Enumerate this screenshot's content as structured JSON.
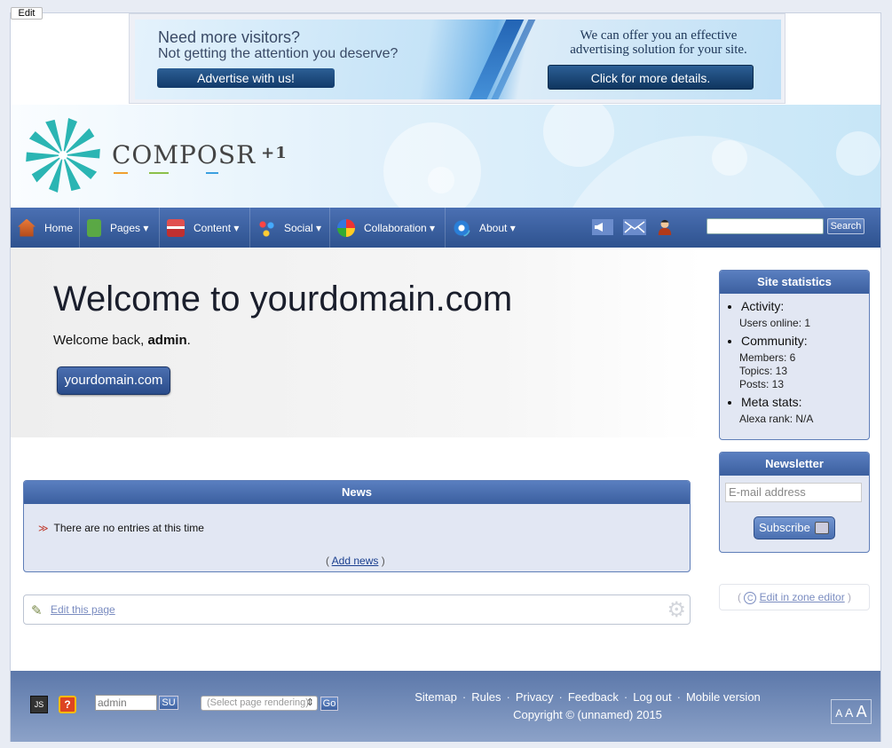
{
  "edit_tab": "Edit",
  "banner": {
    "line1": "Need more visitors?",
    "line2": "Not getting the attention you deserve?",
    "left_button": "Advertise with us!",
    "right_text": "We can offer you an effective advertising solution for your site.",
    "right_button": "Click for more details."
  },
  "logo": {
    "name": "COMPOSR",
    "suffix": "+1"
  },
  "nav": {
    "items": [
      {
        "label": "Home",
        "icon": "home-icon"
      },
      {
        "label": "Pages ▾",
        "icon": "pages-icon"
      },
      {
        "label": "Content ▾",
        "icon": "content-icon"
      },
      {
        "label": "Social ▾",
        "icon": "social-icon"
      },
      {
        "label": "Collaboration ▾",
        "icon": "collaboration-icon"
      },
      {
        "label": "About ▾",
        "icon": "about-icon"
      }
    ],
    "search_button": "Search"
  },
  "hero": {
    "title": "Welcome to yourdomain.com",
    "welcome_prefix": "Welcome back, ",
    "username": "admin",
    "welcome_suffix": ".",
    "site_button": "yourdomain.com"
  },
  "news": {
    "title": "News",
    "empty_message": "There are no entries at this time",
    "add_link": "Add news",
    "add_open": "(",
    "add_close": ")"
  },
  "edit_page_link": "Edit this page",
  "stats": {
    "title": "Site statistics",
    "activity_label": "Activity:",
    "users_online": "Users online:  1",
    "community_label": "Community:",
    "members": "Members:  6",
    "topics": "Topics:  13",
    "posts": "Posts:  13",
    "meta_label": "Meta stats:",
    "alexa": "Alexa rank:  N/A"
  },
  "newsletter": {
    "title": "Newsletter",
    "placeholder": "E-mail address",
    "subscribe": "Subscribe"
  },
  "zone_editor": {
    "open": "(",
    "link": "Edit in zone editor",
    "close": ")"
  },
  "footer": {
    "js_label": "JS",
    "help_label": "?",
    "username": "admin",
    "su_label": "SU",
    "select_placeholder": "(Select page rendering)",
    "go_label": "Go",
    "links": [
      "Sitemap",
      "Rules",
      "Privacy",
      "Feedback",
      "Log out",
      "Mobile version"
    ],
    "separator": "·",
    "copyright": "Copyright © (unnamed) 2015",
    "font_size_labels": [
      "A",
      "A",
      "A"
    ]
  }
}
